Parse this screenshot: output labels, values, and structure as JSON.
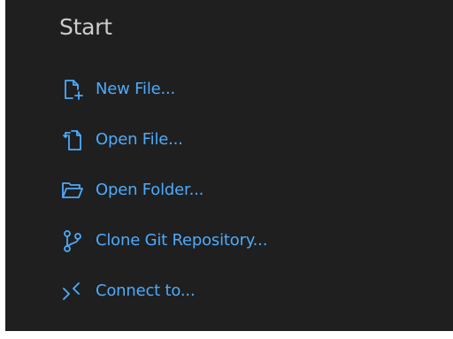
{
  "section": {
    "title": "Start"
  },
  "items": [
    {
      "label": "New File...",
      "icon": "new-file-icon"
    },
    {
      "label": "Open File...",
      "icon": "open-file-icon"
    },
    {
      "label": "Open Folder...",
      "icon": "open-folder-icon"
    },
    {
      "label": "Clone Git Repository...",
      "icon": "git-branch-icon"
    },
    {
      "label": "Connect to...",
      "icon": "remote-connect-icon"
    }
  ],
  "colors": {
    "background": "#1f1f1f",
    "title": "#cccccc",
    "link": "#4daafc"
  }
}
